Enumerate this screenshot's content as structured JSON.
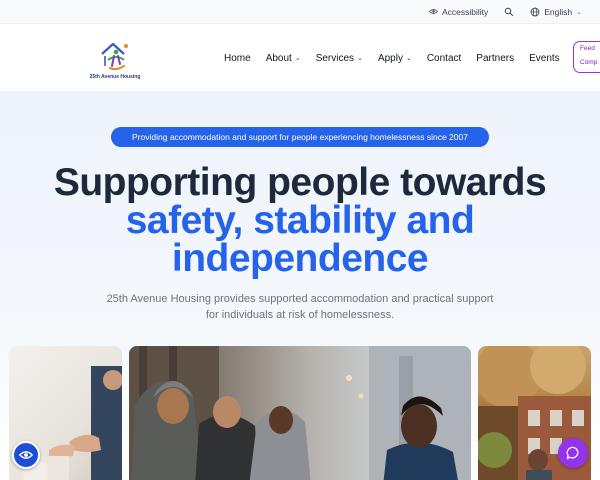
{
  "utility": {
    "accessibility_label": "Accessibility",
    "language_label": "English"
  },
  "header": {
    "logo_text": "25th Avenue Housing",
    "nav": [
      {
        "label": "Home",
        "dropdown": false
      },
      {
        "label": "About",
        "dropdown": true
      },
      {
        "label": "Services",
        "dropdown": true
      },
      {
        "label": "Apply",
        "dropdown": true
      },
      {
        "label": "Contact",
        "dropdown": false
      },
      {
        "label": "Partners",
        "dropdown": false
      },
      {
        "label": "Events",
        "dropdown": false
      }
    ],
    "feedback_line1": "Feed",
    "feedback_line2": "Comp"
  },
  "hero": {
    "pill_text": "Providing accommodation and support for people experiencing homelessness since 2007",
    "title_line1": "Supporting people towards",
    "title_line2": "safety, stability and",
    "title_line3": "independence",
    "subtitle": "25th Avenue Housing provides supported accommodation and practical support for individuals at risk of homelessness."
  },
  "colors": {
    "brand_blue": "#2563eb",
    "accent_purple": "#9333ea",
    "title_dark": "#1e293b"
  }
}
